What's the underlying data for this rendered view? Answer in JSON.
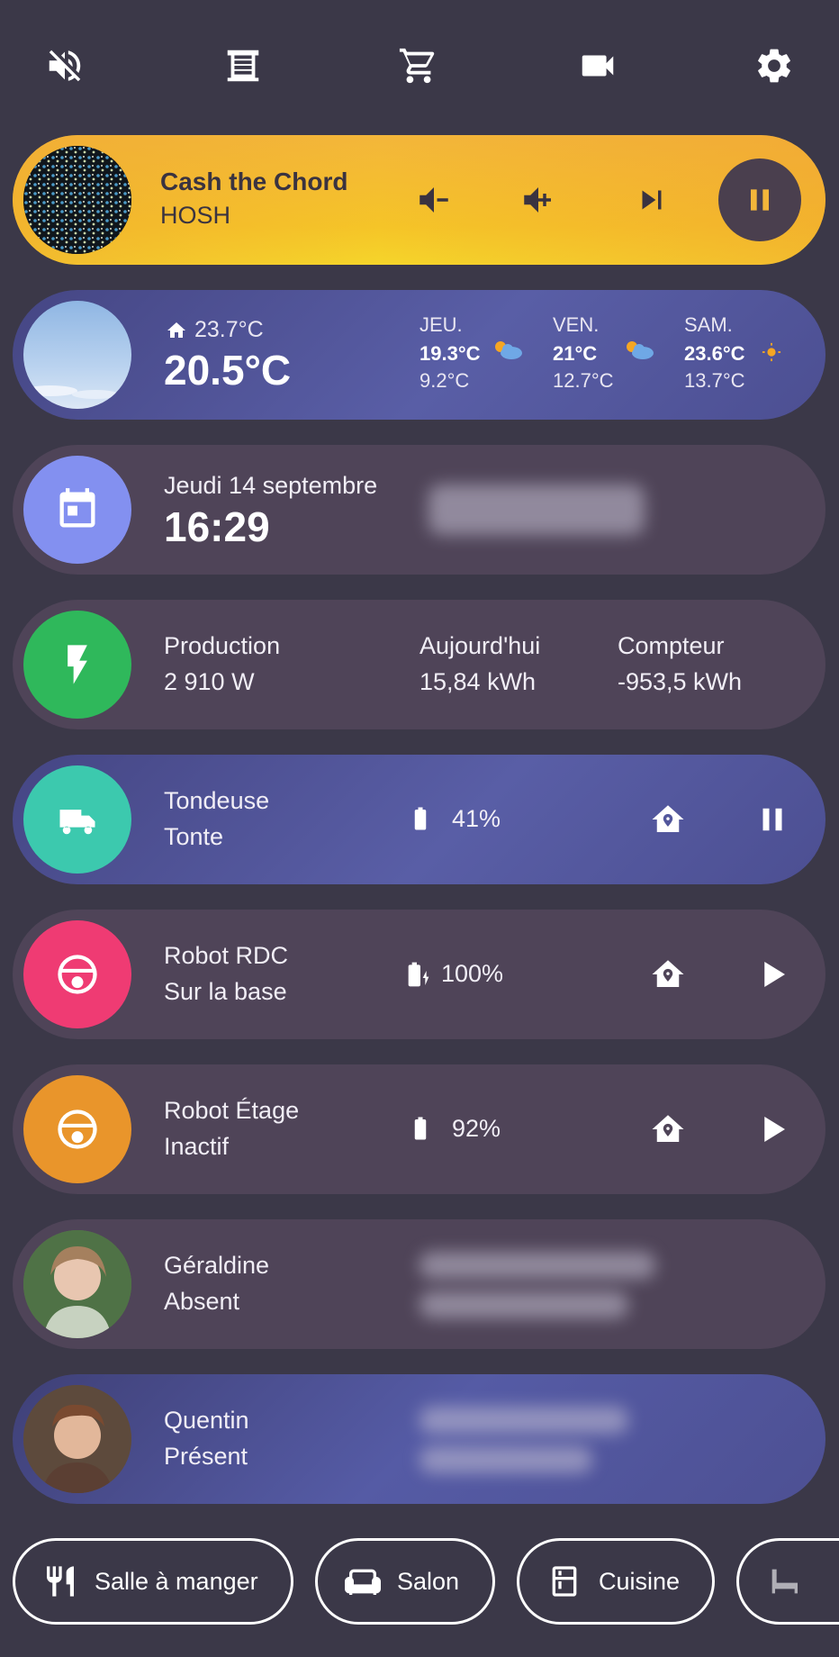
{
  "topbar": {
    "icons": [
      "mute-icon",
      "blinds-icon",
      "cart-icon",
      "camera-icon",
      "settings-icon"
    ]
  },
  "media": {
    "title": "Cash the Chord",
    "artist": "HOSH",
    "controls": [
      "volume-down-icon",
      "volume-up-icon",
      "skip-next-icon",
      "pause-icon"
    ]
  },
  "weather": {
    "indoor": "23.7°C",
    "outdoor": "20.5°C",
    "days": [
      {
        "day": "JEU.",
        "high": "19.3°C",
        "low": "9.2°C",
        "icon": "partly-cloudy-icon"
      },
      {
        "day": "VEN.",
        "high": "21°C",
        "low": "12.7°C",
        "icon": "partly-cloudy-icon"
      },
      {
        "day": "SAM.",
        "high": "23.6°C",
        "low": "13.7°C",
        "icon": "sunny-icon"
      }
    ]
  },
  "calendar": {
    "date": "Jeudi 14 septembre",
    "time": "16:29"
  },
  "energy": {
    "production_label": "Production",
    "production_value": "2 910  W",
    "today_label": "Aujourd'hui",
    "today_value": "15,84  kWh",
    "meter_label": "Compteur",
    "meter_value": "-953,5  kWh"
  },
  "mower": {
    "name": "Tondeuse",
    "state": "Tonte",
    "battery": "41%",
    "accent": "#3cc9ae"
  },
  "robot_rdc": {
    "name": "Robot RDC",
    "state": "Sur la base",
    "battery": "100%",
    "accent": "#ef3b73"
  },
  "robot_etage": {
    "name": "Robot Étage",
    "state": "Inactif",
    "battery": "92%",
    "accent": "#e9952b"
  },
  "person1": {
    "name": "Géraldine",
    "state": "Absent"
  },
  "person2": {
    "name": "Quentin",
    "state": "Présent"
  },
  "rooms": [
    {
      "label": "Salle à manger",
      "icon": "cutlery-icon"
    },
    {
      "label": "Salon",
      "icon": "sofa-icon"
    },
    {
      "label": "Cuisine",
      "icon": "fridge-icon"
    }
  ],
  "colors": {
    "background": "#3b3848",
    "card": "#4f4458",
    "calendar": "#8390f0",
    "energy": "#2fb85b"
  }
}
